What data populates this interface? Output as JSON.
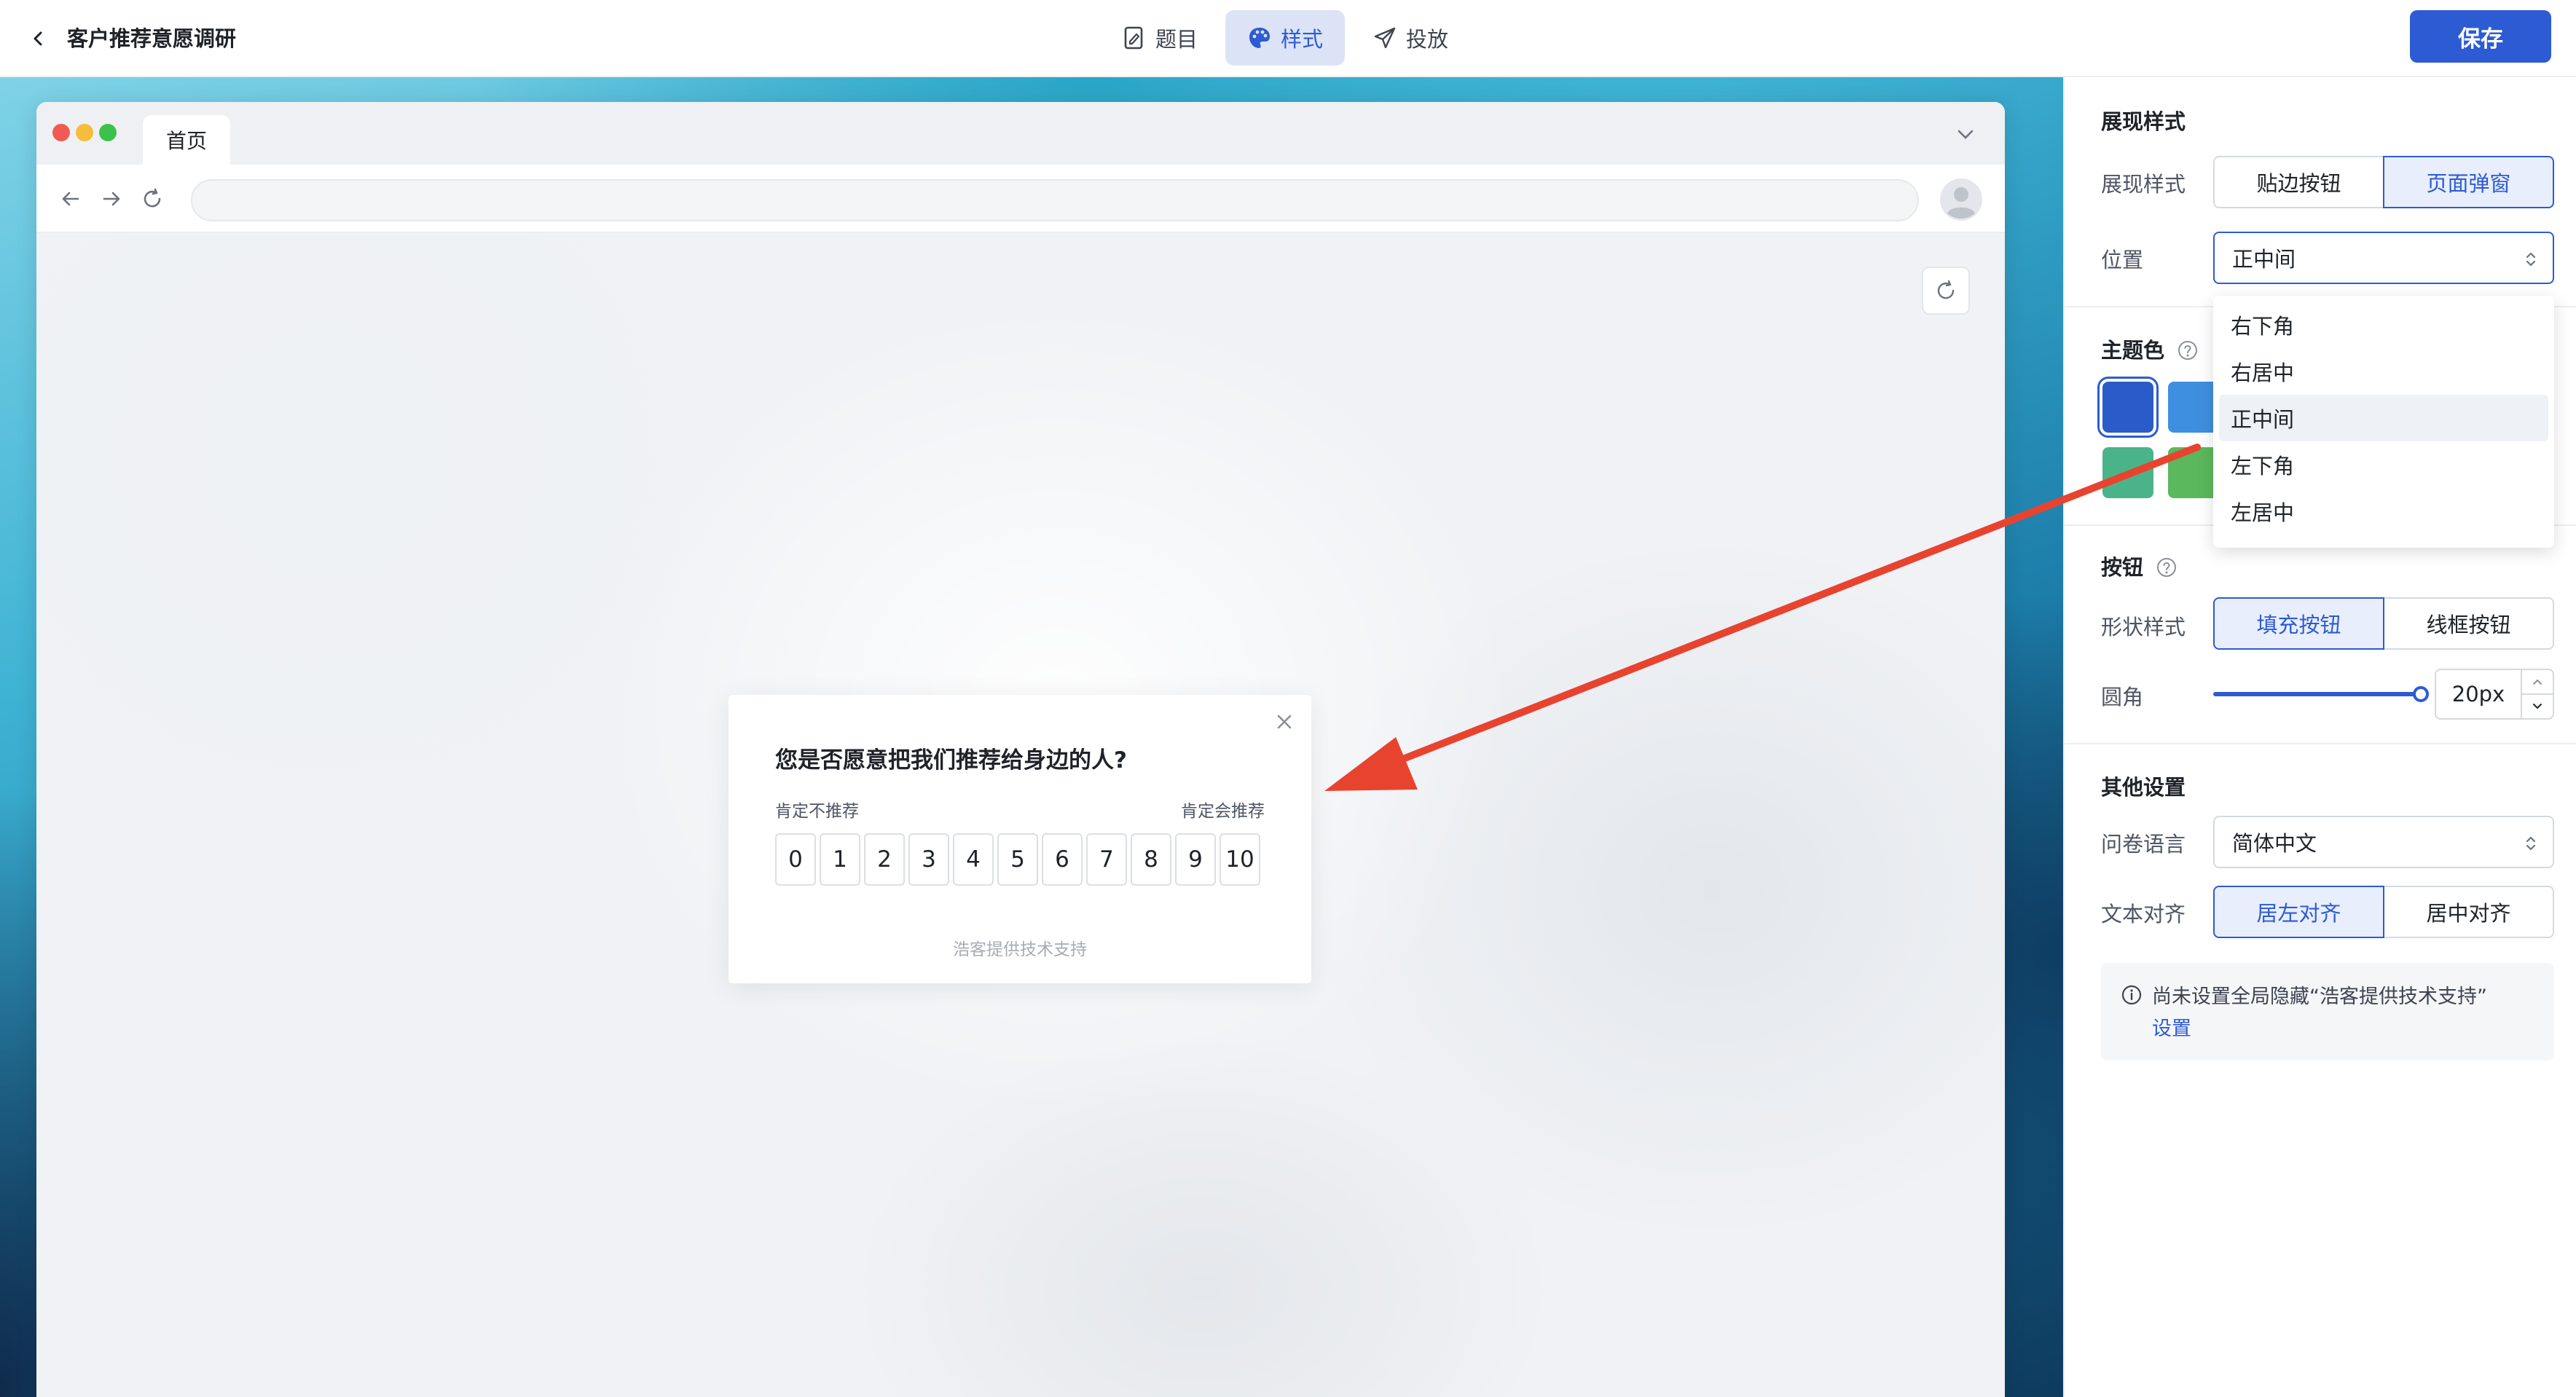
{
  "header": {
    "title": "客户推荐意愿调研",
    "tabs": [
      {
        "label": "题目",
        "icon": "document-edit-icon"
      },
      {
        "label": "样式",
        "icon": "palette-icon",
        "active": true
      },
      {
        "label": "投放",
        "icon": "send-icon"
      }
    ],
    "save_label": "保存"
  },
  "preview": {
    "browser_tab_label": "首页",
    "popup": {
      "question": "您是否愿意把我们推荐给身边的人?",
      "left_label": "肯定不推荐",
      "right_label": "肯定会推荐",
      "scale": [
        "0",
        "1",
        "2",
        "3",
        "4",
        "5",
        "6",
        "7",
        "8",
        "9",
        "10"
      ],
      "footer": "浩客提供技术支持"
    }
  },
  "panel": {
    "display_section_title": "展现样式",
    "display_style_label": "展现样式",
    "display_options": [
      "贴边按钮",
      "页面弹窗"
    ],
    "display_selected": "页面弹窗",
    "position_label": "位置",
    "position_value": "正中间",
    "position_options": [
      "右下角",
      "右居中",
      "正中间",
      "左下角",
      "左居中"
    ],
    "theme_section_title": "主题色",
    "theme_colors": [
      "#2a5bc9",
      "#3f8fe0",
      "#4bb38a",
      "#5bb85c"
    ],
    "button_section_title": "按钮",
    "shape_label": "形状样式",
    "shape_options": [
      "填充按钮",
      "线框按钮"
    ],
    "shape_selected": "填充按钮",
    "radius_label": "圆角",
    "radius_value": "20px",
    "other_section_title": "其他设置",
    "language_label": "问卷语言",
    "language_value": "简体中文",
    "align_label": "文本对齐",
    "align_options": [
      "居左对齐",
      "居中对齐"
    ],
    "align_selected": "居左对齐",
    "notice_text": "尚未设置全局隐藏“浩客提供技术支持”",
    "notice_link": "设置"
  },
  "colors": {
    "accent": "#2d5bd3",
    "annotation_arrow": "#e8432f"
  }
}
